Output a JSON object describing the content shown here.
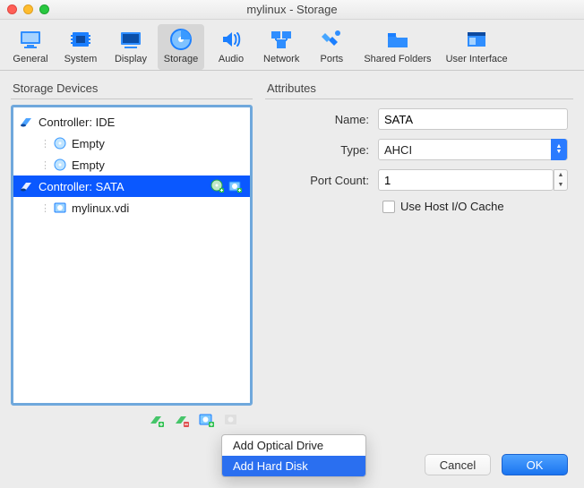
{
  "window": {
    "title": "mylinux - Storage"
  },
  "toolbar": {
    "items": [
      {
        "label": "General"
      },
      {
        "label": "System"
      },
      {
        "label": "Display"
      },
      {
        "label": "Storage"
      },
      {
        "label": "Audio"
      },
      {
        "label": "Network"
      },
      {
        "label": "Ports"
      },
      {
        "label": "Shared Folders"
      },
      {
        "label": "User Interface"
      }
    ]
  },
  "sections": {
    "devices_title": "Storage Devices",
    "attributes_title": "Attributes"
  },
  "tree": {
    "controller_ide": "Controller: IDE",
    "empty": "Empty",
    "controller_sata": "Controller: SATA",
    "vdi": "mylinux.vdi"
  },
  "attributes": {
    "name_label": "Name:",
    "name_value": "SATA",
    "type_label": "Type:",
    "type_value": "AHCI",
    "portcount_label": "Port Count:",
    "portcount_value": "1",
    "hostio_label": "Use Host I/O Cache"
  },
  "context_menu": {
    "optical": "Add Optical Drive",
    "harddisk": "Add Hard Disk"
  },
  "footer": {
    "cancel": "Cancel",
    "ok": "OK"
  }
}
